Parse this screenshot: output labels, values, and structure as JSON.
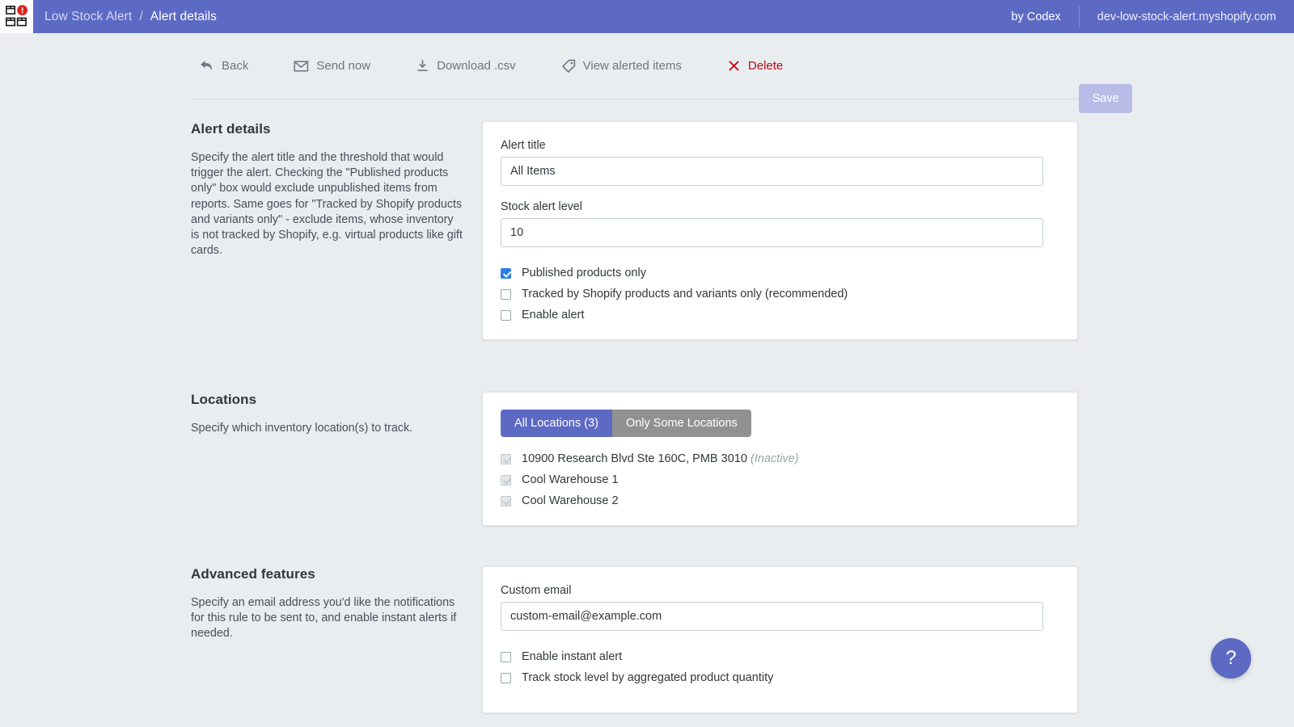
{
  "topbar": {
    "logo_icon": "boxes-alert-logo-icon",
    "breadcrumb_parent": "Low Stock Alert",
    "breadcrumb_separator": "/",
    "breadcrumb_current": "Alert details",
    "by_line": "by Codex",
    "shop_domain": "dev-low-stock-alert.myshopify.com",
    "accent_color": "#5c6ac4"
  },
  "toolbar": {
    "back_label": "Back",
    "send_now_label": "Send now",
    "download_csv_label": "Download .csv",
    "view_alerted_items_label": "View alerted items",
    "delete_label": "Delete",
    "delete_color": "#bf0711",
    "save_label": "Save",
    "save_disabled_color": "#b8bde8"
  },
  "alert_details": {
    "title": "Alert details",
    "description": "Specify the alert title and the threshold that would trigger the alert. Checking the \"Published products only\" box would exclude unpublished items from reports. Same goes for \"Tracked by Shopify products and variants only\" - exclude items, whose inventory is not tracked by Shopify, e.g. virtual products like gift cards.",
    "alert_title_label": "Alert title",
    "alert_title_value": "All Items",
    "stock_alert_level_label": "Stock alert level",
    "stock_alert_level_value": "10",
    "checkboxes": [
      {
        "label": "Published products only",
        "checked": true
      },
      {
        "label": "Tracked by Shopify products and variants only (recommended)",
        "checked": false
      },
      {
        "label": "Enable alert",
        "checked": false
      }
    ],
    "checked_color": "#2b7de9"
  },
  "locations": {
    "title": "Locations",
    "description": "Specify which inventory location(s) to track.",
    "toggle": {
      "all_label": "All Locations (3)",
      "some_label": "Only Some Locations",
      "selected": "all",
      "active_color": "#5c6ac4",
      "inactive_color": "#919191"
    },
    "items": [
      {
        "name": "10900 Research Blvd Ste 160C, PMB 3010",
        "status": "(Inactive)",
        "checked": true,
        "disabled": true
      },
      {
        "name": "Cool Warehouse 1",
        "status": "",
        "checked": true,
        "disabled": true
      },
      {
        "name": "Cool Warehouse 2",
        "status": "",
        "checked": true,
        "disabled": true
      }
    ]
  },
  "advanced": {
    "title": "Advanced features",
    "description": "Specify an email address you'd like the notifications for this rule to be sent to, and enable instant alerts if needed.",
    "custom_email_label": "Custom email",
    "custom_email_value": "custom-email@example.com",
    "checkboxes": [
      {
        "label": "Enable instant alert",
        "checked": false
      },
      {
        "label": "Track stock level by aggregated product quantity",
        "checked": false
      }
    ]
  },
  "help": {
    "label": "?"
  }
}
